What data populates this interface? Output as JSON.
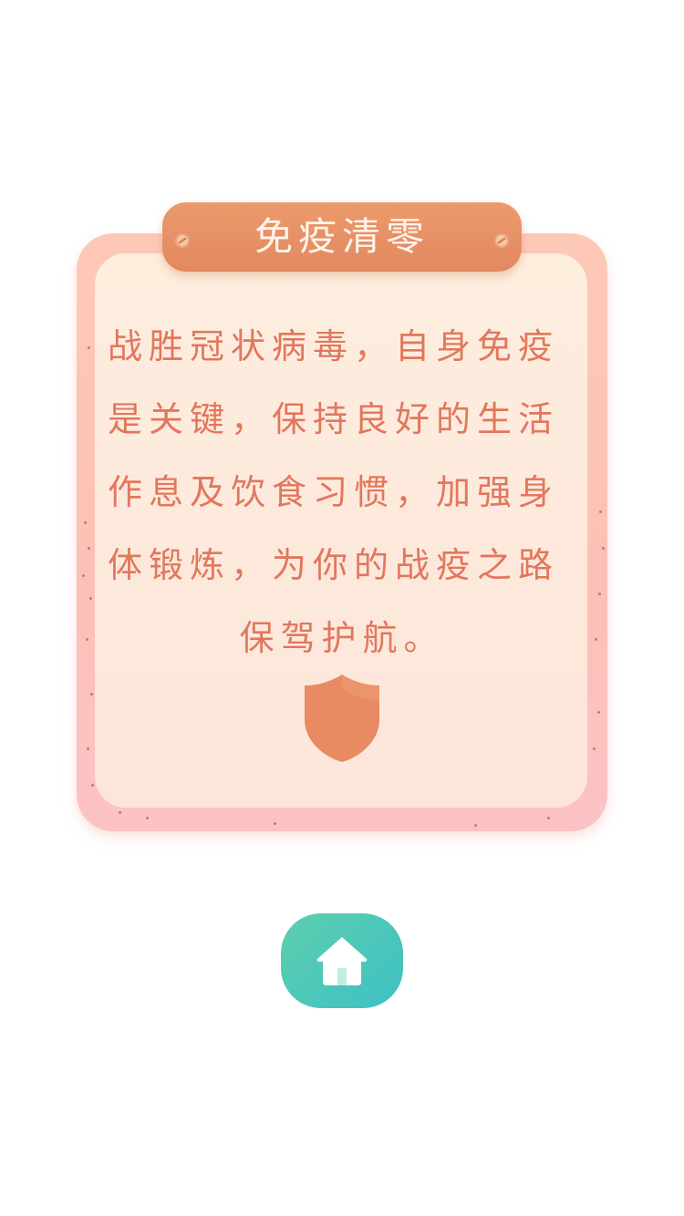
{
  "card": {
    "title": "免疫清零",
    "lines": [
      "战胜冠状病毒，自身免疫",
      "是关键，保持良好的生活",
      "作息及饮食习惯，加强身",
      "体锻炼，为你的战疫之路",
      "保驾护航。"
    ]
  },
  "icons": {
    "shield": "shield-icon",
    "home": "home-icon"
  },
  "colors": {
    "title_plaque": "#e48a60",
    "body_text": "#e2775d",
    "card_frame": "#fcc3b8",
    "card_inner": "#fdeede",
    "shield": "#e88a62",
    "home_button": "#4ec8b8"
  }
}
